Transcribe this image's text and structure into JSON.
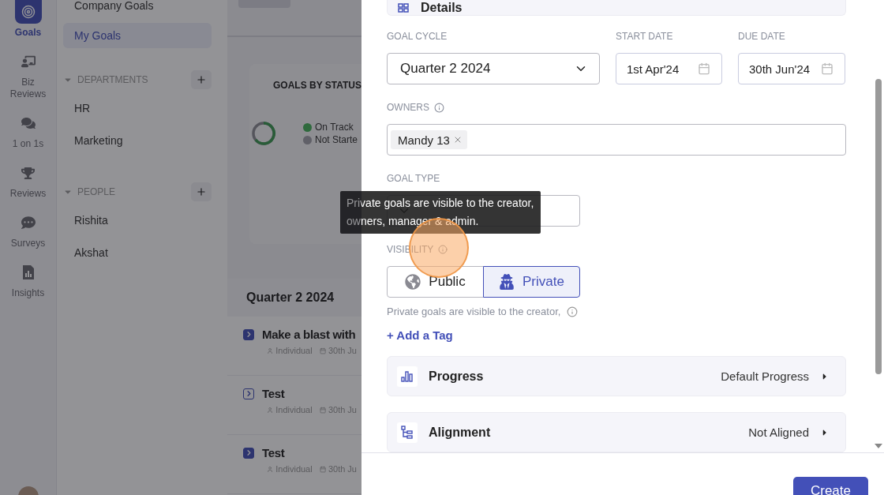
{
  "rail": {
    "items": [
      {
        "label": "Goals",
        "kind": "goals",
        "selected": true
      },
      {
        "label": "Biz Reviews",
        "kind": "biz",
        "selected": false
      },
      {
        "label": "1 on 1s",
        "kind": "chat",
        "selected": false
      },
      {
        "label": "Reviews",
        "kind": "trophy",
        "selected": false
      },
      {
        "label": "Surveys",
        "kind": "survey",
        "selected": false
      },
      {
        "label": "Insights",
        "kind": "insights",
        "selected": false
      }
    ]
  },
  "nav": {
    "top_items": [
      {
        "label": "Company Goals",
        "selected": false
      },
      {
        "label": "My Goals",
        "selected": true
      }
    ],
    "sections": [
      {
        "title": "DEPARTMENTS",
        "expanded": true,
        "items": [
          "HR",
          "Marketing"
        ]
      },
      {
        "title": "PEOPLE",
        "expanded": true,
        "items": [
          "Rishita",
          "Akshat"
        ]
      }
    ]
  },
  "main": {
    "status_card": {
      "title": "GOALS BY STATUS",
      "legend": [
        {
          "label": "On Track",
          "color": "#2f6a3d"
        },
        {
          "label": "Not Starte",
          "color": "#606068"
        }
      ]
    },
    "cycle_title": "Quarter 2 2024",
    "goals": [
      {
        "title": "Make a blast with",
        "type": "Individual",
        "due": "30th Ju",
        "kind": "filled"
      },
      {
        "title": "Test",
        "type": "Individual",
        "due": "30th Ju",
        "kind": "outlined"
      },
      {
        "title": "Test",
        "type": "Individual",
        "due": "30th Ju",
        "kind": "filled"
      }
    ]
  },
  "drawer": {
    "details_title": "Details",
    "goal_cycle": {
      "label": "GOAL CYCLE",
      "value": "Quarter 2 2024"
    },
    "start_date": {
      "label": "START DATE",
      "value": "1st Apr'24"
    },
    "due_date": {
      "label": "DUE DATE",
      "value": "30th Jun'24"
    },
    "owners": {
      "label": "OWNERS",
      "tags": [
        "Mandy 13"
      ]
    },
    "goal_type": {
      "label": "GOAL TYPE"
    },
    "visibility": {
      "label": "VISIBILITY",
      "options": [
        {
          "label": "Public",
          "kind": "public",
          "selected": false
        },
        {
          "label": "Private",
          "kind": "private",
          "selected": true
        }
      ],
      "helper": "Private goals are visible to the creator,"
    },
    "add_tag": "+ Add a Tag",
    "sections": [
      {
        "title": "Progress",
        "value": "Default Progress",
        "kind": "progress"
      },
      {
        "title": "Alignment",
        "value": "Not Aligned",
        "kind": "alignment"
      }
    ],
    "create_button": "Create"
  },
  "tooltip": "Private goals are visible to the creator, owners, manager & admin."
}
